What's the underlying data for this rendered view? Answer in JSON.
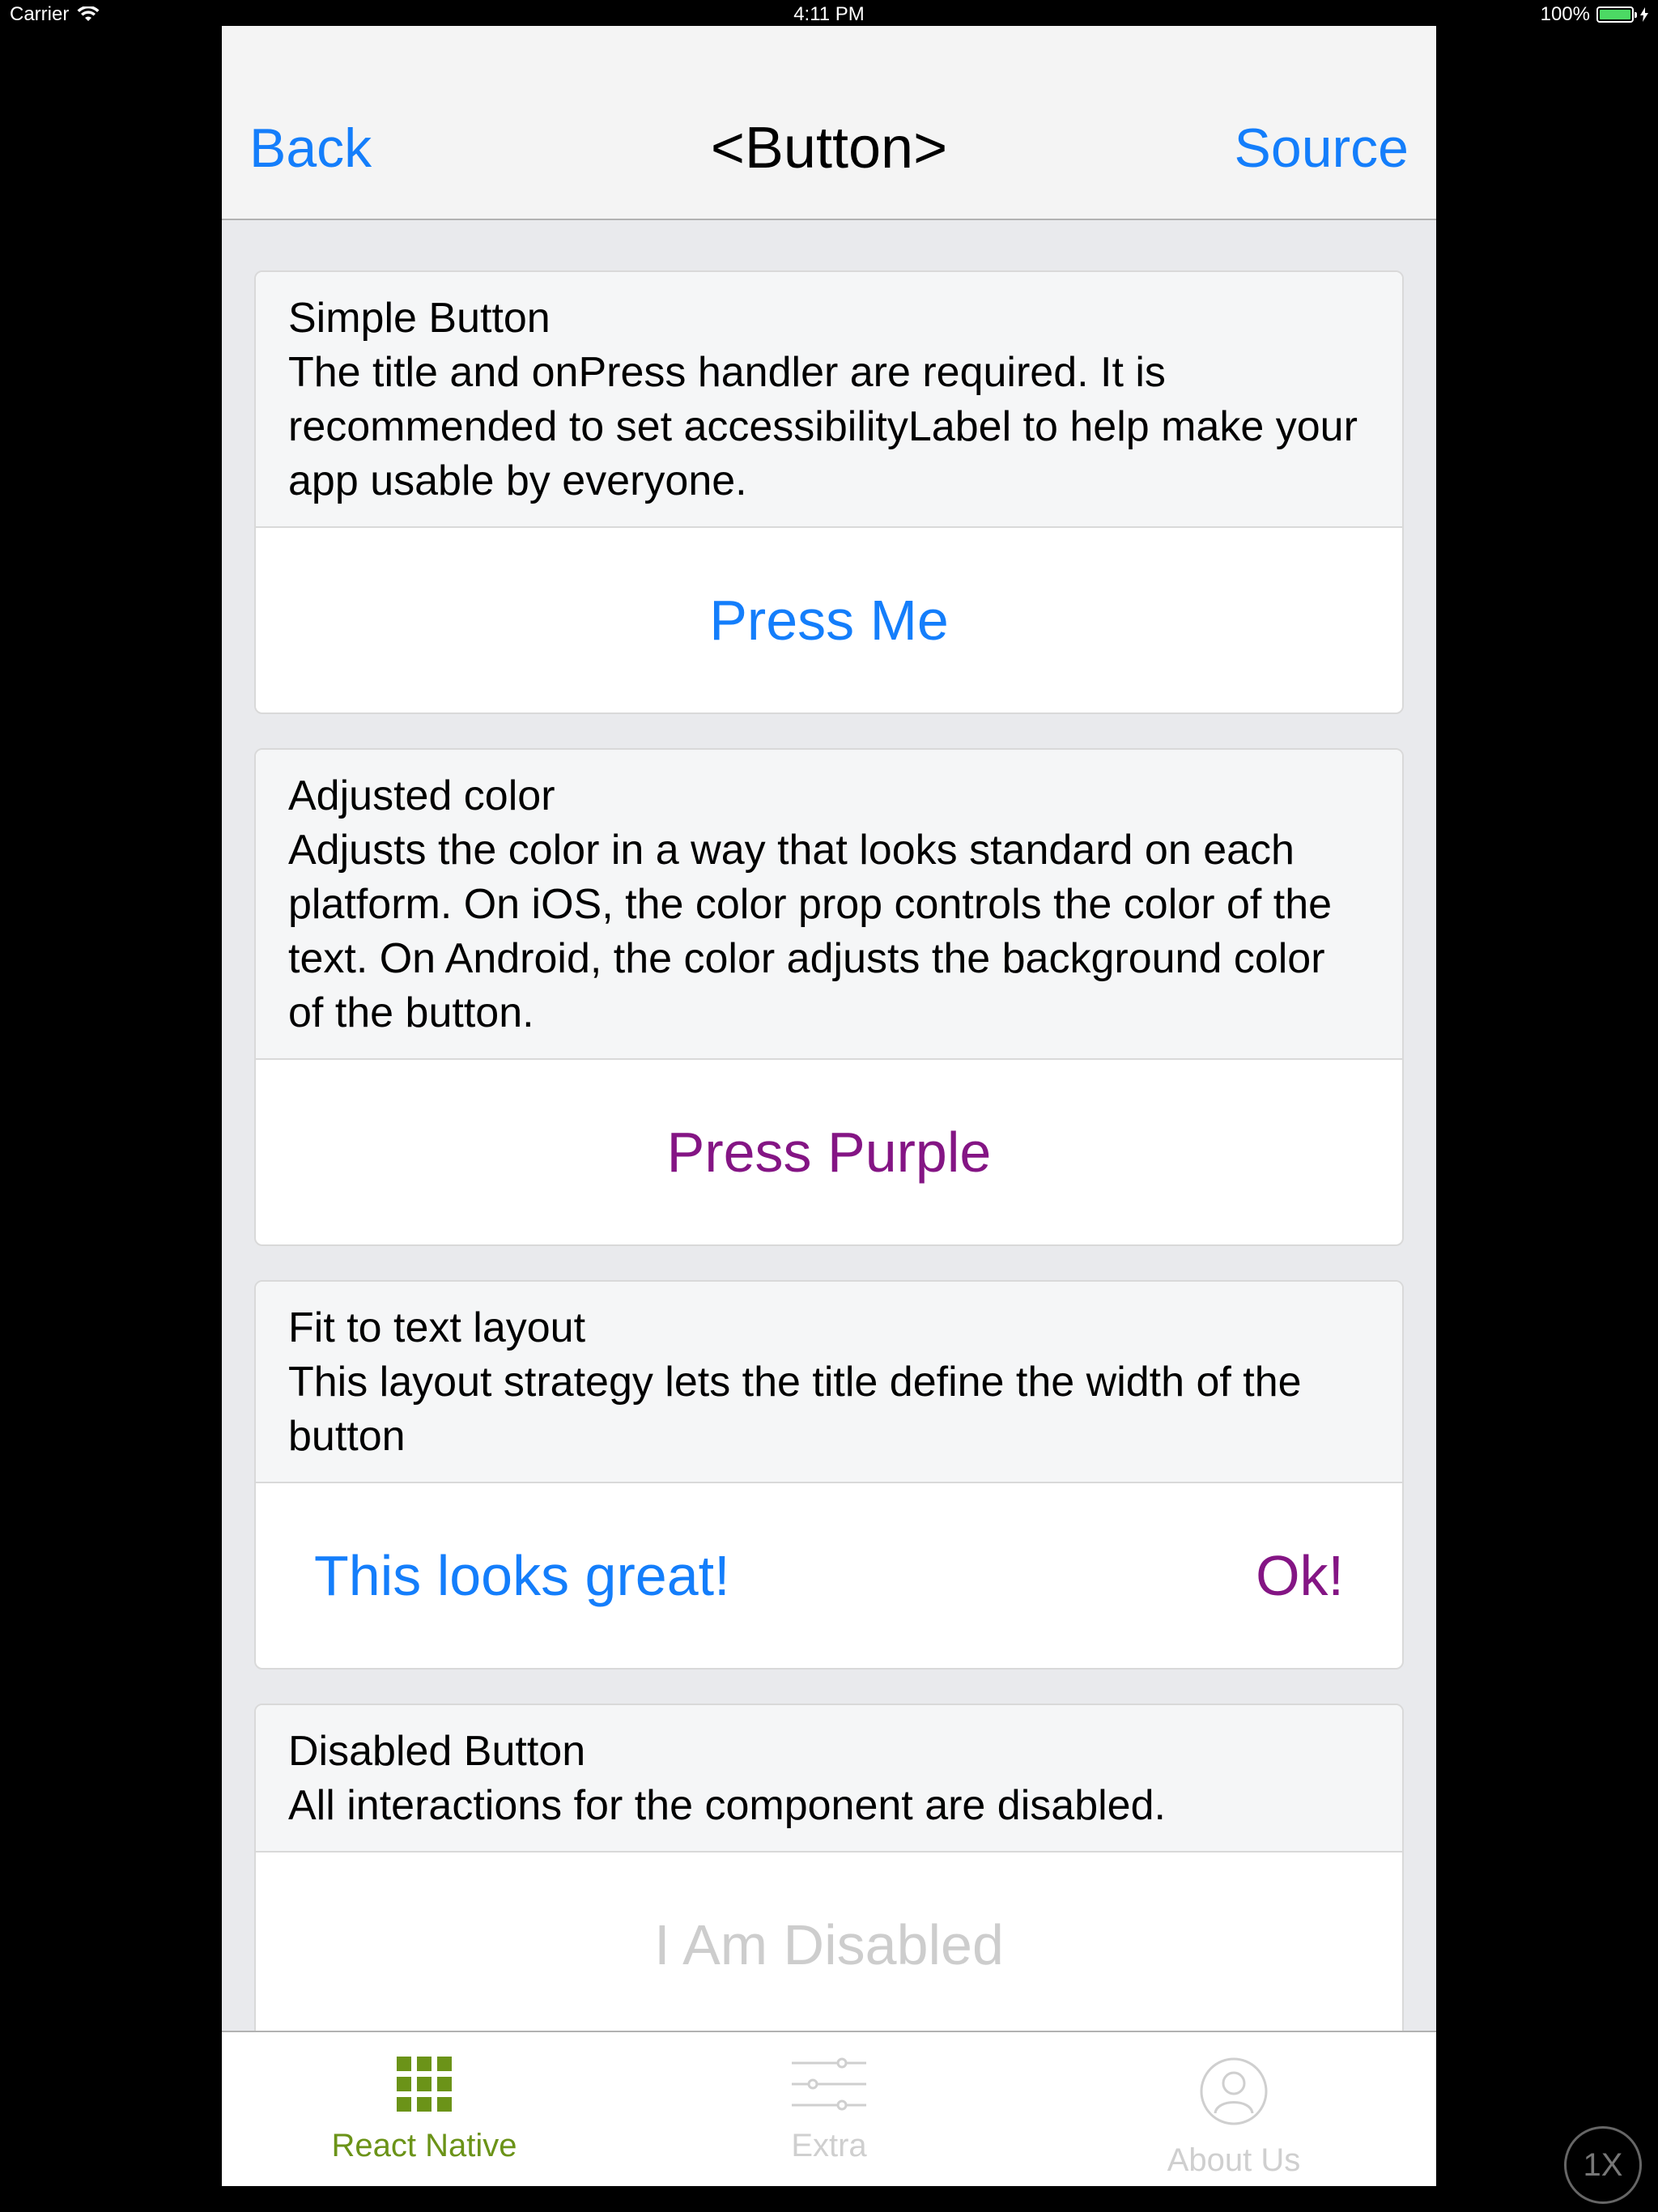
{
  "status_bar": {
    "carrier": "Carrier",
    "time": "4:11 PM",
    "battery": "100%",
    "battery_level": 1.0
  },
  "navbar": {
    "back_label": "Back",
    "title": "<Button>",
    "source_label": "Source"
  },
  "cards": [
    {
      "title": "Simple Button",
      "description": "The title and onPress handler are required. It is recommended to set accessibilityLabel to help make your app usable by everyone.",
      "button": "Press Me"
    },
    {
      "title": "Adjusted color",
      "description": "Adjusts the color in a way that looks standard on each platform. On iOS, the color prop controls the color of the text. On Android, the color adjusts the background color of the button.",
      "button": "Press Purple"
    },
    {
      "title": "Fit to text layout",
      "description": "This layout strategy lets the title define the width of the button",
      "button_left": "This looks great!",
      "button_right": "Ok!"
    },
    {
      "title": "Disabled Button",
      "description": "All interactions for the component are disabled.",
      "button": "I Am Disabled"
    }
  ],
  "tabbar": {
    "tabs": [
      {
        "label": "React Native",
        "icon": "grid-icon",
        "active": true
      },
      {
        "label": "Extra",
        "icon": "sliders-icon",
        "active": false
      },
      {
        "label": "About Us",
        "icon": "user-icon",
        "active": false
      }
    ]
  },
  "zoom_badge": "1X",
  "colors": {
    "accent_blue": "#147efb",
    "accent_purple": "#841584",
    "tab_active": "#6b9318",
    "disabled": "#cdcdcd"
  }
}
